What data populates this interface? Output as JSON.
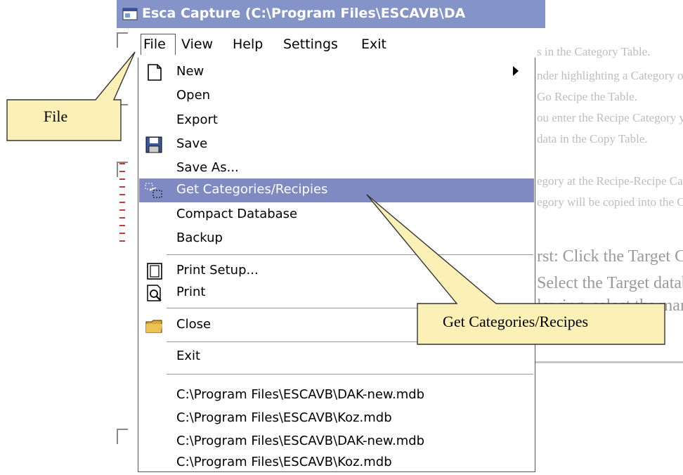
{
  "window": {
    "title": "Esca Capture (C:\\Program Files\\ESCAVB\\DA"
  },
  "menubar": {
    "items": [
      "File",
      "View",
      "Help",
      "Settings",
      "Exit"
    ]
  },
  "file_menu": {
    "items": [
      {
        "label": "New",
        "icon": "new-document-icon",
        "submenu": true
      },
      {
        "label": "Open",
        "icon": ""
      },
      {
        "label": "Export",
        "icon": ""
      },
      {
        "label": "Save",
        "icon": "floppy-disk-icon"
      },
      {
        "label": "Save As...",
        "icon": ""
      },
      {
        "label": "Get Categories/Recipies",
        "icon": "get-categories-icon",
        "highlighted": true
      },
      {
        "label": "Compact Database",
        "icon": ""
      },
      {
        "label": "Backup",
        "icon": ""
      },
      {
        "label": "Print Setup...",
        "icon": "print-setup-icon"
      },
      {
        "label": "Print",
        "icon": "print-preview-icon"
      },
      {
        "label": "Close",
        "icon": "folder-icon"
      },
      {
        "label": "Exit",
        "icon": ""
      }
    ],
    "recent_files": [
      "C:\\Program Files\\ESCAVB\\DAK-new.mdb",
      "C:\\Program Files\\ESCAVB\\Koz.mdb",
      "C:\\Program Files\\ESCAVB\\DAK-new.mdb",
      "C:\\Program Files\\ESCAVB\\Koz.mdb"
    ]
  },
  "callouts": {
    "file": "File",
    "get_categories": "Get Categories/Recipes"
  },
  "background_document": {
    "lines": [
      "s in the Category Table.",
      "nder highlighting a Category or Recipe. To",
      "Go Recipe the Table.",
      "ou enter the Recipe Category you ll edit",
      "data in the Copy Table.",
      "egory at the Recipe-Recipe Category",
      "egory will be copied into the Category of"
    ],
    "big_lines": [
      "rst: Click the Target Category shown",
      "Select the Target database (the one you",
      "lowing, select the marked Recipes left in"
    ]
  },
  "colors": {
    "titlebar": "#8594c8",
    "highlight": "#7f89c2",
    "callout_fill": "#fbf1b6"
  }
}
